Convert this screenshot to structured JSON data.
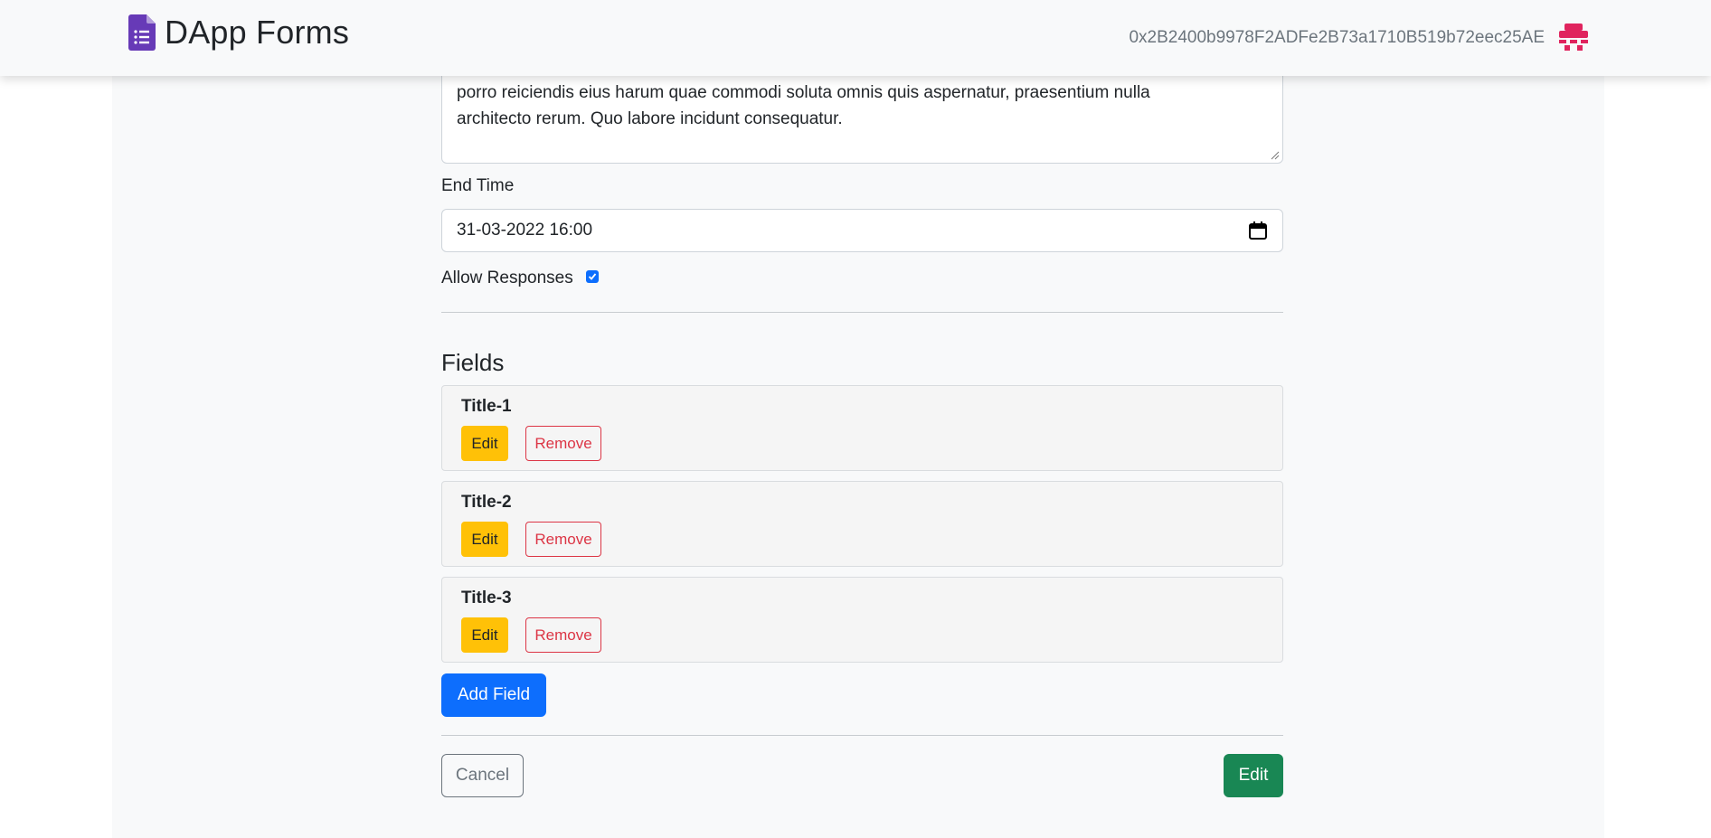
{
  "brand": {
    "name": "DApp Forms",
    "icon": "google-forms-icon",
    "color": "#673ab7"
  },
  "account": {
    "address": "0x2B2400b9978F2ADFe2B73a1710B519b72eec25AE",
    "avatar": "identicon",
    "avatar_color": "#e0245e"
  },
  "form": {
    "description_line1": "porro reiciendis eius harum quae commodi soluta omnis quis aspernatur, praesentium nulla",
    "description_line2": "architecto rerum. Quo labore incidunt consequatur.",
    "end_time_label": "End Time",
    "end_time_value": "31-03-2022 16:00",
    "allow_responses_label": "Allow Responses",
    "allow_responses_checked": true
  },
  "fields_section": {
    "title": "Fields",
    "items": [
      {
        "title": "Title-1",
        "edit_label": "Edit",
        "remove_label": "Remove"
      },
      {
        "title": "Title-2",
        "edit_label": "Edit",
        "remove_label": "Remove"
      },
      {
        "title": "Title-3",
        "edit_label": "Edit",
        "remove_label": "Remove"
      }
    ],
    "add_label": "Add Field"
  },
  "actions": {
    "cancel_label": "Cancel",
    "submit_label": "Edit"
  },
  "colors": {
    "primary": "#0d6efd",
    "warning": "#ffc107",
    "danger": "#dc3545",
    "success": "#198754",
    "secondary": "#6c757d"
  }
}
